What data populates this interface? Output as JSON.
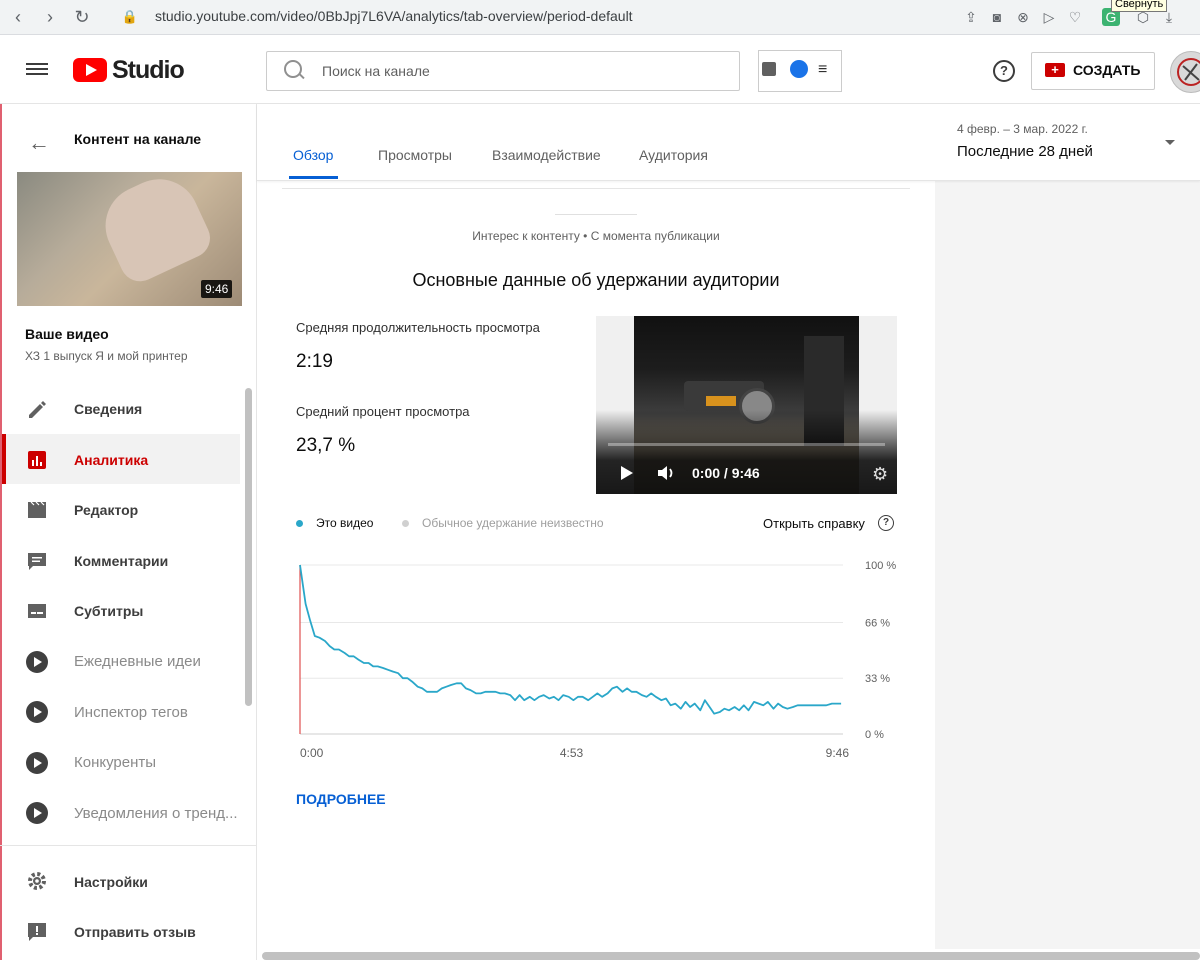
{
  "browser": {
    "url": "studio.youtube.com/video/0BbJpj7L6VA/analytics/tab-overview/period-default",
    "tooltip": "Свернуть"
  },
  "header": {
    "logo_text": "Studio",
    "search_placeholder": "Поиск на канале",
    "help_glyph": "?",
    "create_label": "СОЗДАТЬ"
  },
  "sidebar": {
    "title": "Контент на канале",
    "thumbnail_duration": "9:46",
    "your_video_label": "Ваше видео",
    "video_name": "ХЗ 1 выпуск Я и мой принтер",
    "items": [
      {
        "label": "Сведения",
        "icon": "pencil-icon"
      },
      {
        "label": "Аналитика",
        "icon": "analytics-icon",
        "active": true
      },
      {
        "label": "Редактор",
        "icon": "clapper-icon"
      },
      {
        "label": "Комментарии",
        "icon": "comment-icon"
      },
      {
        "label": "Субтитры",
        "icon": "subtitles-icon"
      },
      {
        "label": "Ежедневные идеи",
        "icon": "extension-icon"
      },
      {
        "label": "Инспектор тегов",
        "icon": "extension-icon"
      },
      {
        "label": "Конкуренты",
        "icon": "extension-icon"
      },
      {
        "label": "Уведомления о тренд...",
        "icon": "extension-icon"
      }
    ],
    "footer": [
      {
        "label": "Настройки",
        "icon": "gear-icon"
      },
      {
        "label": "Отправить отзыв",
        "icon": "feedback-icon"
      }
    ]
  },
  "tabs": [
    "Обзор",
    "Просмотры",
    "Взаимодействие",
    "Аудитория"
  ],
  "active_tab": "Обзор",
  "period": {
    "date_range": "4 февр. – 3 мар. 2022 г.",
    "label": "Последние 28 дней"
  },
  "main": {
    "context": "Интерес к контенту • С момента публикации",
    "title": "Основные данные об удержании аудитории",
    "avg_duration_label": "Средняя продолжительность просмотра",
    "avg_duration_value": "2:19",
    "avg_percent_label": "Средний процент просмотра",
    "avg_percent_value": "23,7 %",
    "player_time": "0:00 / 9:46",
    "legend_this_video": "Это видео",
    "legend_typical": "Обычное удержание неизвестно",
    "help_link": "Открыть справку",
    "more_label": "ПОДРОБНЕЕ"
  },
  "colors": {
    "accent": "#065fd4",
    "brand_red": "#ff0000",
    "series_line": "#2aa7c9",
    "legend_typical": "#d0d0d0"
  },
  "chart_data": {
    "type": "line",
    "xlabel": "",
    "ylabel": "",
    "x_ticks": [
      "0:00",
      "4:53",
      "9:46"
    ],
    "y_ticks": [
      "100 %",
      "66 %",
      "33 %",
      "0 %"
    ],
    "xlim": [
      0,
      586
    ],
    "ylim": [
      0,
      100
    ],
    "grid": true,
    "legend_position": "top-left",
    "series": [
      {
        "name": "Это видео",
        "x": [
          0,
          6,
          11,
          16,
          21,
          27,
          32,
          37,
          42,
          48,
          53,
          58,
          63,
          69,
          74,
          79,
          84,
          90,
          95,
          100,
          106,
          111,
          116,
          121,
          127,
          132,
          137,
          142,
          148,
          153,
          158,
          163,
          169,
          174,
          179,
          184,
          190,
          195,
          200,
          205,
          211,
          216,
          221,
          227,
          232,
          237,
          242,
          248,
          253,
          258,
          263,
          269,
          274,
          279,
          284,
          290,
          295,
          300,
          305,
          311,
          316,
          321,
          326,
          332,
          337,
          342,
          348,
          353,
          358,
          363,
          369,
          374,
          379,
          384,
          390,
          395,
          400,
          405,
          411,
          416,
          421,
          426,
          432,
          437,
          442,
          447,
          453,
          458,
          463,
          469,
          474,
          479,
          484,
          490,
          495,
          500,
          505,
          511,
          516,
          521,
          526,
          532,
          537,
          542,
          547,
          553,
          558,
          563,
          568,
          574,
          579,
          584
        ],
        "y": [
          100,
          77,
          67,
          58,
          57,
          55,
          52,
          50,
          50,
          48,
          46,
          46,
          44,
          42,
          42,
          40,
          40,
          39,
          38,
          37,
          36,
          33,
          33,
          31,
          28,
          27,
          25,
          25,
          25,
          27,
          28,
          29,
          30,
          30,
          27,
          26,
          24,
          24,
          25,
          25,
          25,
          24,
          24,
          23,
          20,
          23,
          20,
          22,
          20,
          22,
          23,
          21,
          22,
          20,
          23,
          22,
          20,
          22,
          22,
          20,
          22,
          24,
          22,
          24,
          27,
          28,
          25,
          27,
          25,
          25,
          23,
          22,
          24,
          22,
          20,
          21,
          17,
          18,
          15,
          19,
          16,
          18,
          14,
          20,
          16,
          12,
          13,
          15,
          14,
          16,
          14,
          17,
          14,
          19,
          18,
          17,
          19,
          15,
          18,
          16,
          15,
          16,
          17,
          17,
          17,
          17,
          17,
          17,
          17,
          18,
          18,
          18
        ]
      }
    ]
  }
}
